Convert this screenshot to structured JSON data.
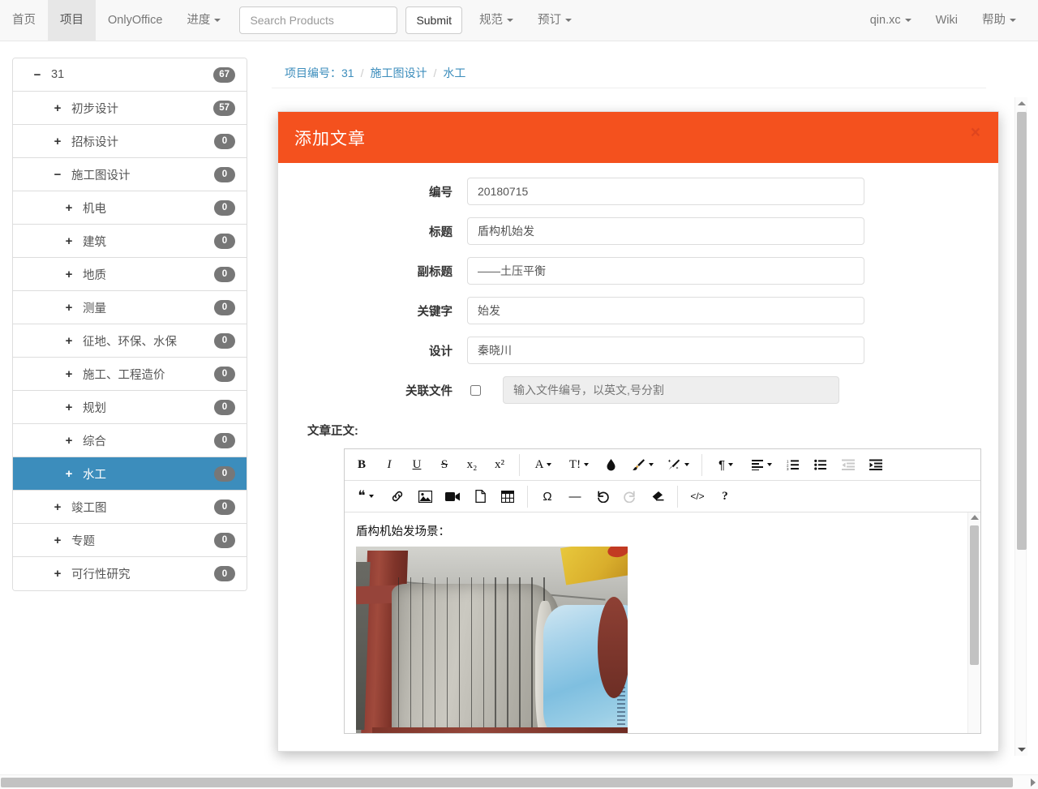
{
  "navbar": {
    "left_items": [
      {
        "label": "首页",
        "active": false,
        "caret": false
      },
      {
        "label": "项目",
        "active": true,
        "caret": false
      },
      {
        "label": "OnlyOffice",
        "active": false,
        "caret": false
      },
      {
        "label": "进度",
        "active": false,
        "caret": true
      }
    ],
    "after_form_items": [
      {
        "label": "规范",
        "active": false,
        "caret": true
      },
      {
        "label": "预订",
        "active": false,
        "caret": true
      }
    ],
    "search": {
      "placeholder": "Search Products",
      "value": ""
    },
    "submit_label": "Submit",
    "right_items": [
      {
        "label": "qin.xc",
        "caret": true
      },
      {
        "label": "Wiki",
        "caret": false
      },
      {
        "label": "帮助",
        "caret": true
      }
    ]
  },
  "sidebar": {
    "items": [
      {
        "label": "31",
        "toggle": "−",
        "badge": "67",
        "level": 0,
        "selected": false
      },
      {
        "label": "初步设计",
        "toggle": "+",
        "badge": "57",
        "level": 1,
        "selected": false
      },
      {
        "label": "招标设计",
        "toggle": "+",
        "badge": "0",
        "level": 1,
        "selected": false
      },
      {
        "label": "施工图设计",
        "toggle": "−",
        "badge": "0",
        "level": 1,
        "selected": false
      },
      {
        "label": "机电",
        "toggle": "+",
        "badge": "0",
        "level": 2,
        "selected": false
      },
      {
        "label": "建筑",
        "toggle": "+",
        "badge": "0",
        "level": 2,
        "selected": false
      },
      {
        "label": "地质",
        "toggle": "+",
        "badge": "0",
        "level": 2,
        "selected": false
      },
      {
        "label": "测量",
        "toggle": "+",
        "badge": "0",
        "level": 2,
        "selected": false
      },
      {
        "label": "征地、环保、水保",
        "toggle": "+",
        "badge": "0",
        "level": 2,
        "selected": false
      },
      {
        "label": "施工、工程造价",
        "toggle": "+",
        "badge": "0",
        "level": 2,
        "selected": false
      },
      {
        "label": "规划",
        "toggle": "+",
        "badge": "0",
        "level": 2,
        "selected": false
      },
      {
        "label": "综合",
        "toggle": "+",
        "badge": "0",
        "level": 2,
        "selected": false
      },
      {
        "label": "水工",
        "toggle": "+",
        "badge": "0",
        "level": 2,
        "selected": true
      },
      {
        "label": "竣工图",
        "toggle": "+",
        "badge": "0",
        "level": 1,
        "selected": false
      },
      {
        "label": "专题",
        "toggle": "+",
        "badge": "0",
        "level": 1,
        "selected": false
      },
      {
        "label": "可行性研究",
        "toggle": "+",
        "badge": "0",
        "level": 1,
        "selected": false
      }
    ]
  },
  "breadcrumb": {
    "items": [
      "项目编号：31",
      "施工图设计",
      "水工"
    ],
    "separator": "/"
  },
  "modal": {
    "title": "添加文章",
    "close_label": "×",
    "header_color": "#f4511e",
    "fields": [
      {
        "label": "编号",
        "value": "20180715",
        "placeholder": ""
      },
      {
        "label": "标题",
        "value": "盾构机始发",
        "placeholder": ""
      },
      {
        "label": "副标题",
        "value": "——土压平衡",
        "placeholder": ""
      },
      {
        "label": "关键字",
        "value": "始发",
        "placeholder": ""
      },
      {
        "label": "设计",
        "value": "秦晓川",
        "placeholder": ""
      }
    ],
    "file_field": {
      "label": "关联文件",
      "checkbox_checked": false,
      "value": "",
      "placeholder": "输入文件编号，以英文,号分割"
    },
    "body_label": "文章正文:"
  },
  "editor": {
    "toolbar_row1": [
      {
        "name": "bold-icon",
        "glyph": "B",
        "style": "bold",
        "dropdown": false,
        "disabled": false
      },
      {
        "name": "italic-icon",
        "glyph": "I",
        "style": "italic",
        "dropdown": false,
        "disabled": false
      },
      {
        "name": "underline-icon",
        "glyph": "U",
        "style": "underline",
        "dropdown": false,
        "disabled": false
      },
      {
        "name": "strikethrough-icon",
        "glyph": "S",
        "style": "strike",
        "dropdown": false,
        "disabled": false
      },
      {
        "name": "subscript-icon",
        "glyph": "x₂",
        "style": "plain",
        "dropdown": false,
        "disabled": false
      },
      {
        "name": "superscript-icon",
        "glyph": "x²",
        "style": "plain",
        "dropdown": false,
        "disabled": false
      },
      {
        "name": "separator",
        "glyph": "",
        "style": "sep",
        "dropdown": false,
        "disabled": false
      },
      {
        "name": "font-family-icon",
        "glyph": "A",
        "style": "plain",
        "dropdown": true,
        "disabled": false
      },
      {
        "name": "font-size-icon",
        "glyph": "T!",
        "style": "plain",
        "dropdown": true,
        "disabled": false
      },
      {
        "name": "text-color-icon",
        "glyph": "drop",
        "style": "svg",
        "dropdown": false,
        "disabled": false
      },
      {
        "name": "background-color-icon",
        "glyph": "brush",
        "style": "svg",
        "dropdown": true,
        "disabled": false
      },
      {
        "name": "clear-formatting-icon",
        "glyph": "wand",
        "style": "svg",
        "dropdown": true,
        "disabled": false
      },
      {
        "name": "separator",
        "glyph": "",
        "style": "sep",
        "dropdown": false,
        "disabled": false
      },
      {
        "name": "paragraph-format-icon",
        "glyph": "¶",
        "style": "plain",
        "dropdown": true,
        "disabled": false
      },
      {
        "name": "align-icon",
        "glyph": "align",
        "style": "svg",
        "dropdown": true,
        "disabled": false
      },
      {
        "name": "ordered-list-icon",
        "glyph": "ol",
        "style": "svg",
        "dropdown": false,
        "disabled": false
      },
      {
        "name": "unordered-list-icon",
        "glyph": "ul",
        "style": "svg",
        "dropdown": false,
        "disabled": false
      },
      {
        "name": "outdent-icon",
        "glyph": "outdent",
        "style": "svg",
        "dropdown": false,
        "disabled": true
      },
      {
        "name": "indent-icon",
        "glyph": "indent",
        "style": "svg",
        "dropdown": false,
        "disabled": false
      }
    ],
    "toolbar_row2": [
      {
        "name": "quote-icon",
        "glyph": "❝",
        "style": "plain",
        "dropdown": true,
        "disabled": false
      },
      {
        "name": "link-icon",
        "glyph": "link",
        "style": "svg",
        "dropdown": false,
        "disabled": false
      },
      {
        "name": "insert-image-icon",
        "glyph": "image",
        "style": "svg",
        "dropdown": false,
        "disabled": false
      },
      {
        "name": "insert-video-icon",
        "glyph": "video",
        "style": "svg",
        "dropdown": false,
        "disabled": false
      },
      {
        "name": "insert-file-icon",
        "glyph": "file",
        "style": "svg",
        "dropdown": false,
        "disabled": false
      },
      {
        "name": "insert-table-icon",
        "glyph": "table",
        "style": "svg",
        "dropdown": false,
        "disabled": false
      },
      {
        "name": "separator",
        "glyph": "",
        "style": "sep",
        "dropdown": false,
        "disabled": false
      },
      {
        "name": "special-character-icon",
        "glyph": "Ω",
        "style": "plain",
        "dropdown": false,
        "disabled": false
      },
      {
        "name": "horizontal-line-icon",
        "glyph": "—",
        "style": "plain",
        "dropdown": false,
        "disabled": false
      },
      {
        "name": "undo-icon",
        "glyph": "undo",
        "style": "svg",
        "dropdown": false,
        "disabled": false
      },
      {
        "name": "redo-icon",
        "glyph": "redo",
        "style": "svg",
        "dropdown": false,
        "disabled": true
      },
      {
        "name": "clear-icon",
        "glyph": "eraser",
        "style": "svg",
        "dropdown": false,
        "disabled": false
      },
      {
        "name": "separator",
        "glyph": "",
        "style": "sep",
        "dropdown": false,
        "disabled": false
      },
      {
        "name": "code-view-icon",
        "glyph": "</>",
        "style": "plain",
        "dropdown": false,
        "disabled": false
      },
      {
        "name": "help-icon",
        "glyph": "?",
        "style": "bold",
        "dropdown": false,
        "disabled": false
      }
    ],
    "content": {
      "paragraph": "盾构机始发场景：",
      "image_alt": "盾构机始发场景照片"
    }
  }
}
